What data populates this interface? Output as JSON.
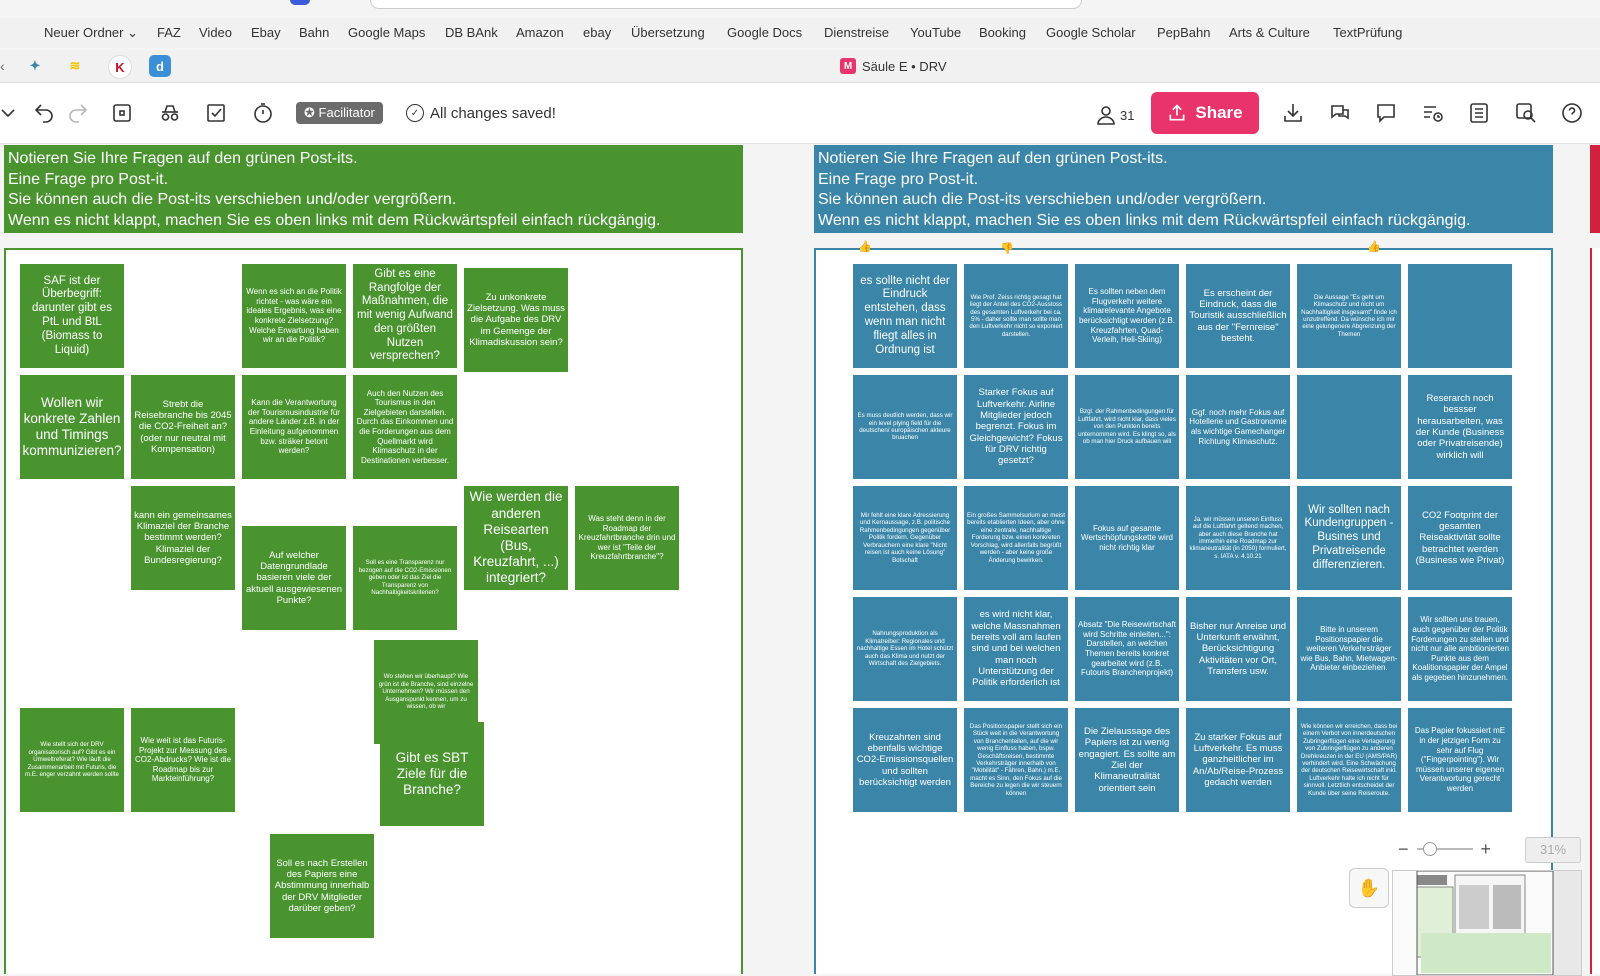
{
  "bookmarks": [
    "Neuer Ordner",
    "FAZ",
    "Video",
    "Ebay",
    "Bahn",
    "Google Maps",
    "DB BAnk",
    "Amazon",
    "ebay",
    "Übersetzung",
    "Google Docs",
    "Dienstreise",
    "YouTube",
    "Booking",
    "Google Scholar",
    "PepBahn",
    "Arts & Culture",
    "TextPrüfung"
  ],
  "tab": {
    "title": "Säule E • DRV"
  },
  "toolbar": {
    "facilitator_label": "Facilitator",
    "saved_status": "All changes saved!",
    "user_count": "31",
    "share_label": "Share"
  },
  "banner_text": [
    "Notieren Sie Ihre Fragen auf den grünen Post-its.",
    "Eine Frage pro Post-it.",
    "Sie können auch die Post-its verschieben und/oder vergrößern.",
    "Wenn es nicht klappt, machen Sie es oben links mit dem Rückwärtspfeil einfach rückgängig."
  ],
  "green_notes": [
    "SAF ist der Überbegriff: darunter gibt es PtL und BtL (Biomass to Liquid)",
    "Wenn es sich an die Politik richtet - was wäre ein ideales Ergebnis, was eine konkrete Zielsetzung? Welche Erwartung haben wir an die Politik?",
    "Gibt es eine Rangfolge der Maßnahmen, die mit wenig Aufwand den größten Nutzen versprechen?",
    "Zu unkonkrete Zielsetzung. Was muss die Aufgabe des DRV im Gemenge der Klimadiskussion sein?",
    "Wollen wir konkrete Zahlen und Timings kommunizieren?",
    "Strebt die Reisebranche bis 2045 die CO2-Freiheit an? (oder nur neutral mit Kompensation)",
    "Kann die Verantwortung der Tourismusindustrie für andere Länder z.B. in der Einleitung aufgenommen bzw. sträker betont werden?",
    "Auch den Nutzen des Tourismus in den Zielgebieten darstellen. Durch das Einkommen und die Forderungen aus dem Quellmarkt wird Klimaschutz in der Destinationen verbesser.",
    "kann ein gemeinsames Klimaziel der Branche bestimmt werden? Klimaziel der Bundesregierung?",
    "Auf welcher Datengrundlade basieren viele der aktuell ausgewiesenen Punkte?",
    "Soll es eine Transparenz nur bezogen auf die CO2-Emissionen geben oder ist das Ziel die Transparenz von Nachhaltigkeitskriterien?",
    "Wie werden die anderen Reisearten (Bus, Kreuzfahrt, ...) integriert?",
    "Was steht denn in der Roadmap der Kreuzfahrtbranche drin und wer ist \"Teile der Kreuzfahrtbranche\"?",
    "Wo stehen wir überhaupt? Wie grün ist die Branche, sind einzelne Unternehmen? Wir müssen den Ausganspunkt kennen, um zu wissen, ob wir",
    "Wie stellt sich der DRV organisatorisch auf? Gibt es ein Umweltreferat? Wie läuft die Zusammenarbeit mit Futuris, die m.E. enger verzahnt werden sollte",
    "Wie weit ist das Futuris-Projekt zur Messung des CO2-Abdrucks? Wie ist die Roadmap bis zur Markteinführung?",
    "Gibt es SBT Ziele für die Branche?",
    "Soll es nach Erstellen des Papiers eine Abstimmung innerhalb der DRV Mitglieder darüber geben?"
  ],
  "blue_notes": [
    "es sollte nicht der Eindruck entstehen, dass wenn man nicht fliegt alles in Ordnung ist",
    "Wie Prof. Zeiss richtig gesagt hat liegt der Anteil des CO2-Ausstoss des gesamten Luftverkehr bei ca. 5% - daher sollte man sollte man den Luftverkehr nicht so exponiert darstellen.",
    "Es sollten neben dem Flugverkehr weitere klimarelevante Angebote berücksichtigt werden (z.B. Kreuzfahrten, Quad-Verleih, Heli-Skiing)",
    "Es erscheint der Eindruck, dass die Touristik ausschließlich aus der \"Fernreise\" besteht.",
    "Die Aussage \"Es geht um Klimaschutz und nicht um Nachhaltigkeit insgesamt\" finde ich unzutreffend. Da wünsche ich mir eine gelungenere Abgrenzung der Themen",
    "",
    "Es muss deutlich werden, dass wir ein level plying field für die deutschen/ europäischen akteure bruachen",
    "Starker Fokus auf Luftverkehr. Airline Mitglieder jedoch begrenzt. Fokus im Gleichgewicht? Fokus für DRV richtig gesetzt?",
    "Bzgl. der Rahmenbedingungen für Luftfahrt, wird nicht klar, dass vieles von den Punkten bereits unternommen wird. Es klingt so, als ob man hier Druck aufbauen will",
    "Ggf. noch mehr Fokus auf Hotellerie und Gastronomie als wichtige Gamechanger Richtung Klimaschutz.",
    "",
    "Reserarch noch bessser herausarbeiten, was der Kunde (Business oder Privatreisende) wirklich will",
    "Mir fehlt eine klare Adressierung und Kernaussage, z.B. politische Rahmenbedingungen gegenüber Politik fordern. Gegenüber Verbrauchern eine klare \"Nicht reisen ist auch keine Lösung\" Botschaft",
    "Ein großes Sammelsurium an meist bereits etablierten Ideen, aber ohne eine zentrale, nachhaltige Forderung bzw. einen konkreten Vorschlag, wird allenfalls begrüßt werden - aber keine große Änderung bewirken.",
    "Fokus auf gesamte Wertschöpfungskette wird nicht richtig klar",
    "Ja. wir müssen unseren Einfluss auf die Luftfahrt geltend machen, aber auch diese Branche hat immerhin eine Roadmap zur klimaneutralität (in 2050) formuliert, s. IATA v. 4.10.21",
    "Wir sollten nach Kundengruppen - Busines und Privatreisende differenzieren.",
    "CO2 Footprint der gesamten Reiseaktivität sollte betrachtet werden (Business wie Privat)",
    "Nahrungsproduktion als Klimatreiber: Regionales und nachhaltige Essen im Hotel schützt auch das Klima und nutzt der Wirtschaft des Zielgebiets.",
    "es wird nicht klar, welche Massnahmen bereits voll am laufen sind und bei welchen man noch Unterstützung der Politik erforderlich ist",
    "Absatz \"Die Reisewirtschaft wird Schritte einleiten...\": Darstellen, an welchen Themen bereits konkret gearbeitet wird (z.B. Futouris Branchenprojekt)",
    "Bisher nur Anreise und Unterkunft erwähnt, Berücksichtigung Aktivitäten vor Ort, Transfers usw.",
    "Bitte in unserem Positionspapier die weiteren Verkehrsträger wie Bus, Bahn, Mietwagen-Anbieter einbeziehen.",
    "Wir sollten uns trauen, auch gegenüber der Politik Forderungen zu stellen und nicht nur alle ambitionierten Punkte aus dem Koalitionspapier der Ampel als gegeben hinzunehmen.",
    "Kreuzahrten sind ebenfalls wichtige CO2-Emissionsquellen und sollten berücksichtigt werden",
    "Das Positionspapier stellt sich ein Stück weit in die Verantwortung von Branchenteilen, auf die wir wenig Einfluss haben, bspw. Geschäftsreisen, bestimmte Verkehrsträger innerhalb von \"Mobilität\" - Fähren, Bahn.) m.E. macht es Sinn, den Fokus auf die Bereiche zu legen die wir steuern können",
    "Die Zielaussage des Papiers ist zu wenig engagiert. Es sollte am Ziel der Klimaneutralität orientiert sein",
    "Zu starker Fokus auf Luftverkehr. Es muss ganzheitlicher im An/Ab/Reise-Prozess gedacht werden",
    "Wie können wir erreichen, dass bei einem Verbot von innerdeutschen Zubringerflügen eine Verlagerung von Zubringerflügen zu anderen Drehkreuzen in der EU (AMS/PAR) verhindert wird. Eine Schwächung der deutschen Reisewirtschaft inkl. Luftverkehr halte ich nicht für sinnvoll. Letztlich entscheidet der Kunde über seine Reiseroute.",
    "Das Papier fokussiert mE in der jetzigen Form zu sehr auf Flug (\"Fingerpointing\"). Wir müssen unserer eigenen Verantwortung gerecht werden"
  ],
  "zoom": {
    "value": "31%"
  },
  "colors": {
    "green_note": "#4a9430",
    "blue_note": "#3b86a8",
    "share": "#e8336b",
    "red_banner": "#d0213f"
  }
}
